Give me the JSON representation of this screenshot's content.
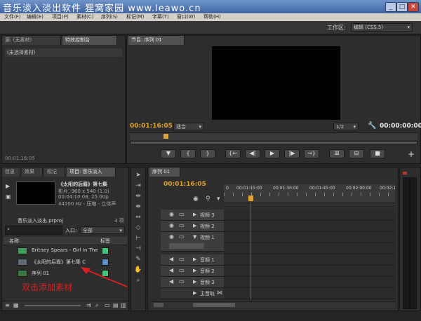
{
  "watermark": {
    "text": "音乐淡入淡出软件  狸窝家园  www.leawo.cn"
  },
  "window": {
    "min": "_",
    "max": "□",
    "close": "✕"
  },
  "menu": [
    "文件(F)",
    "编辑(E)",
    "项目(P)",
    "素材(C)",
    "序列(S)",
    "标记(M)",
    "字幕(T)",
    "窗口(W)",
    "帮助(H)"
  ],
  "workspace": {
    "label": "工作区:",
    "value": "编辑 (CSS.5)"
  },
  "source_panel": {
    "tabs": [
      "源: (无素材)",
      "特效控制台"
    ],
    "message": "(未选择素材)",
    "timecode": "00:01:16:05"
  },
  "program_monitor": {
    "tab": "节目: 序列 01",
    "current_time": "00:01:16:05",
    "fit": "适合",
    "scale": "1/2",
    "duration": "00:00:00:00",
    "controls": [
      "▼",
      "{",
      "}",
      "{←",
      "◀|",
      "▶",
      "|▶",
      "→}",
      "⊞",
      "⊟",
      "📷"
    ],
    "add": "+"
  },
  "project_panel": {
    "tabs": [
      "信息",
      "效果",
      "标记",
      "项目: 音乐淡入"
    ],
    "clip_title": "《太阳的后裔》第七集",
    "clip_line1": "影片, 960 x 540 (1.0)",
    "clip_line2": "00:04:10:08, 25.00p",
    "clip_line3": "44100 Hz - 压缩 - 立体声",
    "project_file": "音乐淡入淡出.prproj",
    "item_count": "3 项",
    "in_label": "入口:",
    "in_value": "全部",
    "columns": {
      "name": "名称",
      "label": "标签"
    },
    "items": [
      {
        "name": "Britney Spears - Girl In The",
        "color": "#3ec878"
      },
      {
        "name": "《太阳的后裔》第七集 C",
        "color": "#5a8fd0"
      },
      {
        "name": "序列 01",
        "color": "#3ec878"
      }
    ],
    "annotation": "双击添加素材"
  },
  "timeline": {
    "tab": "序列 01",
    "timecode": "00:01:16:05",
    "ruler": [
      "00:01:15:00",
      "00:01:30:00",
      "00:01:45:00",
      "00:02:00:00",
      "00:02:1"
    ],
    "ruler_start": "0",
    "video_tracks": [
      "视频 3",
      "视频 2",
      "视频 1"
    ],
    "audio_tracks": [
      "音频 1",
      "音频 2",
      "音频 3"
    ],
    "master": "主音轨"
  },
  "colors": {
    "timecode": "#e2a32a",
    "playhead": "#c0392b",
    "annotation": "#e02020"
  }
}
